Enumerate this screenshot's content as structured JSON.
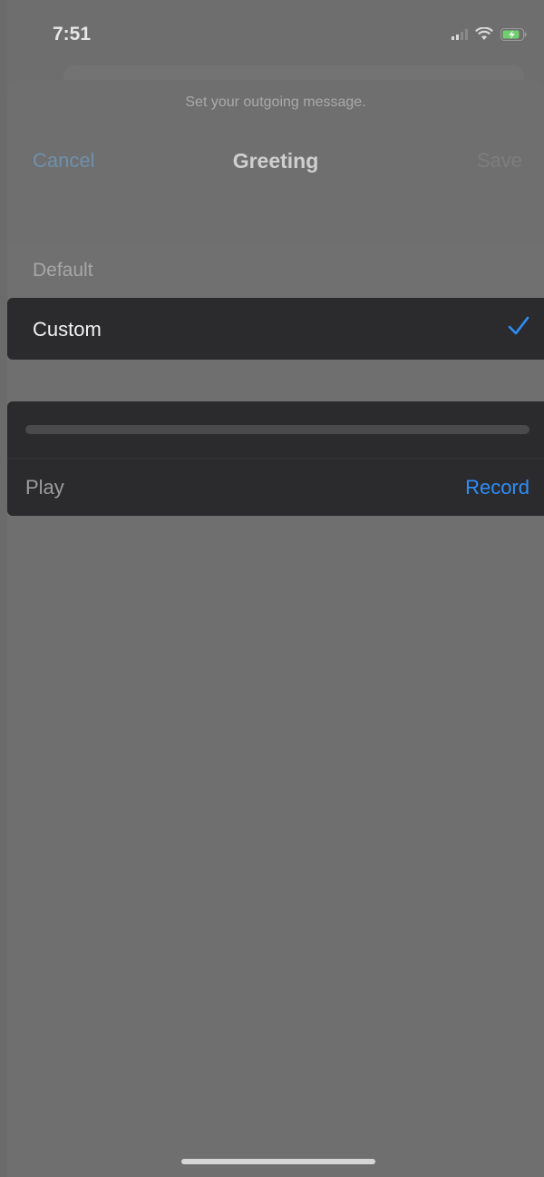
{
  "status_bar": {
    "time": "7:51",
    "icons": [
      "cellular-signal-icon",
      "wifi-icon",
      "battery-charging-icon"
    ]
  },
  "sheet": {
    "prompt": "Set your outgoing message."
  },
  "nav": {
    "cancel_label": "Cancel",
    "title": "Greeting",
    "save_label": "Save"
  },
  "options": {
    "default_label": "Default",
    "custom_label": "Custom",
    "selected": "Custom"
  },
  "recorder": {
    "progress": 0,
    "play_label": "Play",
    "record_label": "Record"
  },
  "colors": {
    "accent": "#2e8ef7",
    "panel": "#2b2b2e",
    "dimmed_background": "#6e6e6e"
  }
}
